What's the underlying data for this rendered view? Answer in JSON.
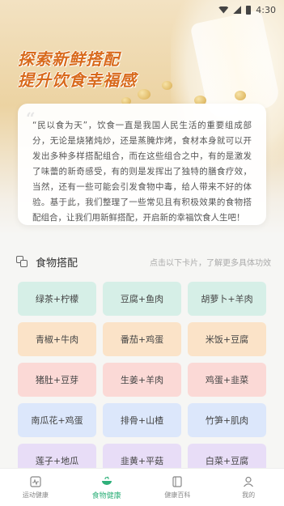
{
  "status_bar": {
    "time": "4:30"
  },
  "hero": {
    "title_line1": "探索新鲜搭配",
    "title_line2": "提升饮食幸福感"
  },
  "intro": {
    "quote_mark": "“",
    "text": "“民以食为天”，饮食一直是我国人民生活的重要组成部分，无论是烧猪炖炒，还是蒸腌炸烤，食材本身就可以开发出多种多样搭配组合，而在这些组合之中，有的是激发了味蕾的新奇感受，有的则是发挥出了独特的膳食疗效，当然，还有一些可能会引发食物中毒，给人带来不好的体验。基于此，我们整理了一些常见且有积极效果的食物搭配组合，让我们用新鲜搭配，开启新的幸福饮食人生吧！"
  },
  "section": {
    "title": "食物搭配",
    "hint": "点击以下卡片，了解更多具体功效"
  },
  "combos": [
    {
      "label": "绿茶+柠檬",
      "color": "green"
    },
    {
      "label": "豆腐+鱼肉",
      "color": "green"
    },
    {
      "label": "胡萝卜+羊肉",
      "color": "green"
    },
    {
      "label": "青椒+牛肉",
      "color": "peach"
    },
    {
      "label": "番茄+鸡蛋",
      "color": "peach"
    },
    {
      "label": "米饭+豆腐",
      "color": "peach"
    },
    {
      "label": "猪肚+豆芽",
      "color": "pink"
    },
    {
      "label": "生姜+羊肉",
      "color": "pink"
    },
    {
      "label": "鸡蛋+韭菜",
      "color": "pink"
    },
    {
      "label": "南瓜花+鸡蛋",
      "color": "blue"
    },
    {
      "label": "排骨+山楂",
      "color": "blue"
    },
    {
      "label": "竹笋+肌肉",
      "color": "blue"
    },
    {
      "label": "莲子+地瓜",
      "color": "purple"
    },
    {
      "label": "韭黄+平菇",
      "color": "purple"
    },
    {
      "label": "白菜+豆腐",
      "color": "purple"
    }
  ],
  "bottom_nav": [
    {
      "label": "运动健康",
      "icon": "activity-icon",
      "active": false
    },
    {
      "label": "食物健康",
      "icon": "food-bowl-icon",
      "active": true
    },
    {
      "label": "健康百科",
      "icon": "book-icon",
      "active": false
    },
    {
      "label": "我的",
      "icon": "user-icon",
      "active": false
    }
  ],
  "colors": {
    "accent": "#2fb07a",
    "title_orange": "#d86a1c",
    "green": "#d6efe7",
    "peach": "#fbe3c8",
    "pink": "#fbd9d6",
    "blue": "#dce7fb",
    "purple": "#e8ddf7"
  }
}
